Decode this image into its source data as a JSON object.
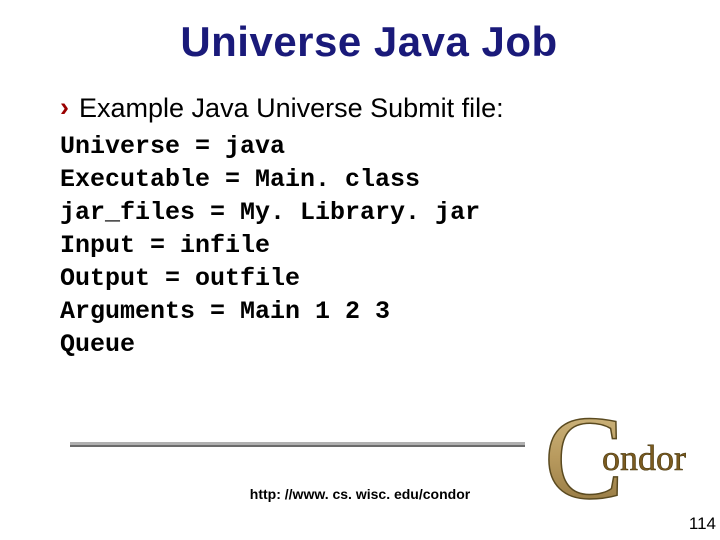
{
  "title": "Universe Java Job",
  "bullet": {
    "glyph": "›",
    "text": "Example Java Universe Submit file:"
  },
  "code_lines": [
    "Universe = java",
    "Executable = Main. class",
    "jar_files = My. Library. jar",
    "Input = infile",
    "Output = outfile",
    "Arguments = Main 1 2 3",
    "Queue"
  ],
  "footer": {
    "url": "http: //www. cs. wisc. edu/condor"
  },
  "page_number": "114",
  "logo": {
    "name": "Condor",
    "letters": "ondor"
  }
}
